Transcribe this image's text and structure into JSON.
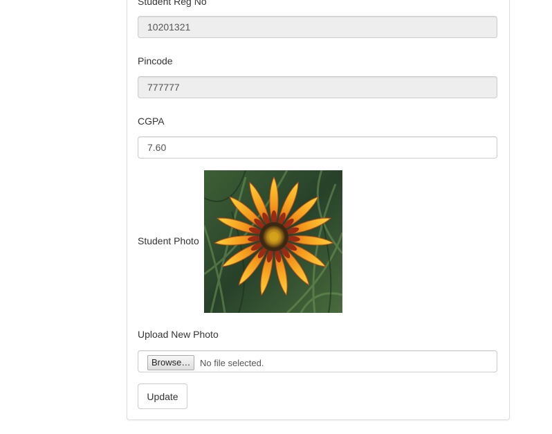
{
  "form": {
    "reg_no": {
      "label": "Student Reg No",
      "value": "10201321"
    },
    "pincode": {
      "label": "Pincode",
      "value": "777777"
    },
    "cgpa": {
      "label": "CGPA",
      "value": "7.60"
    },
    "photo": {
      "label": "Student Photo",
      "alt": "Student Photo"
    },
    "upload": {
      "label": "Upload New Photo",
      "browse_label": "Browse…",
      "status": "No file selected."
    },
    "update_label": "Update"
  }
}
